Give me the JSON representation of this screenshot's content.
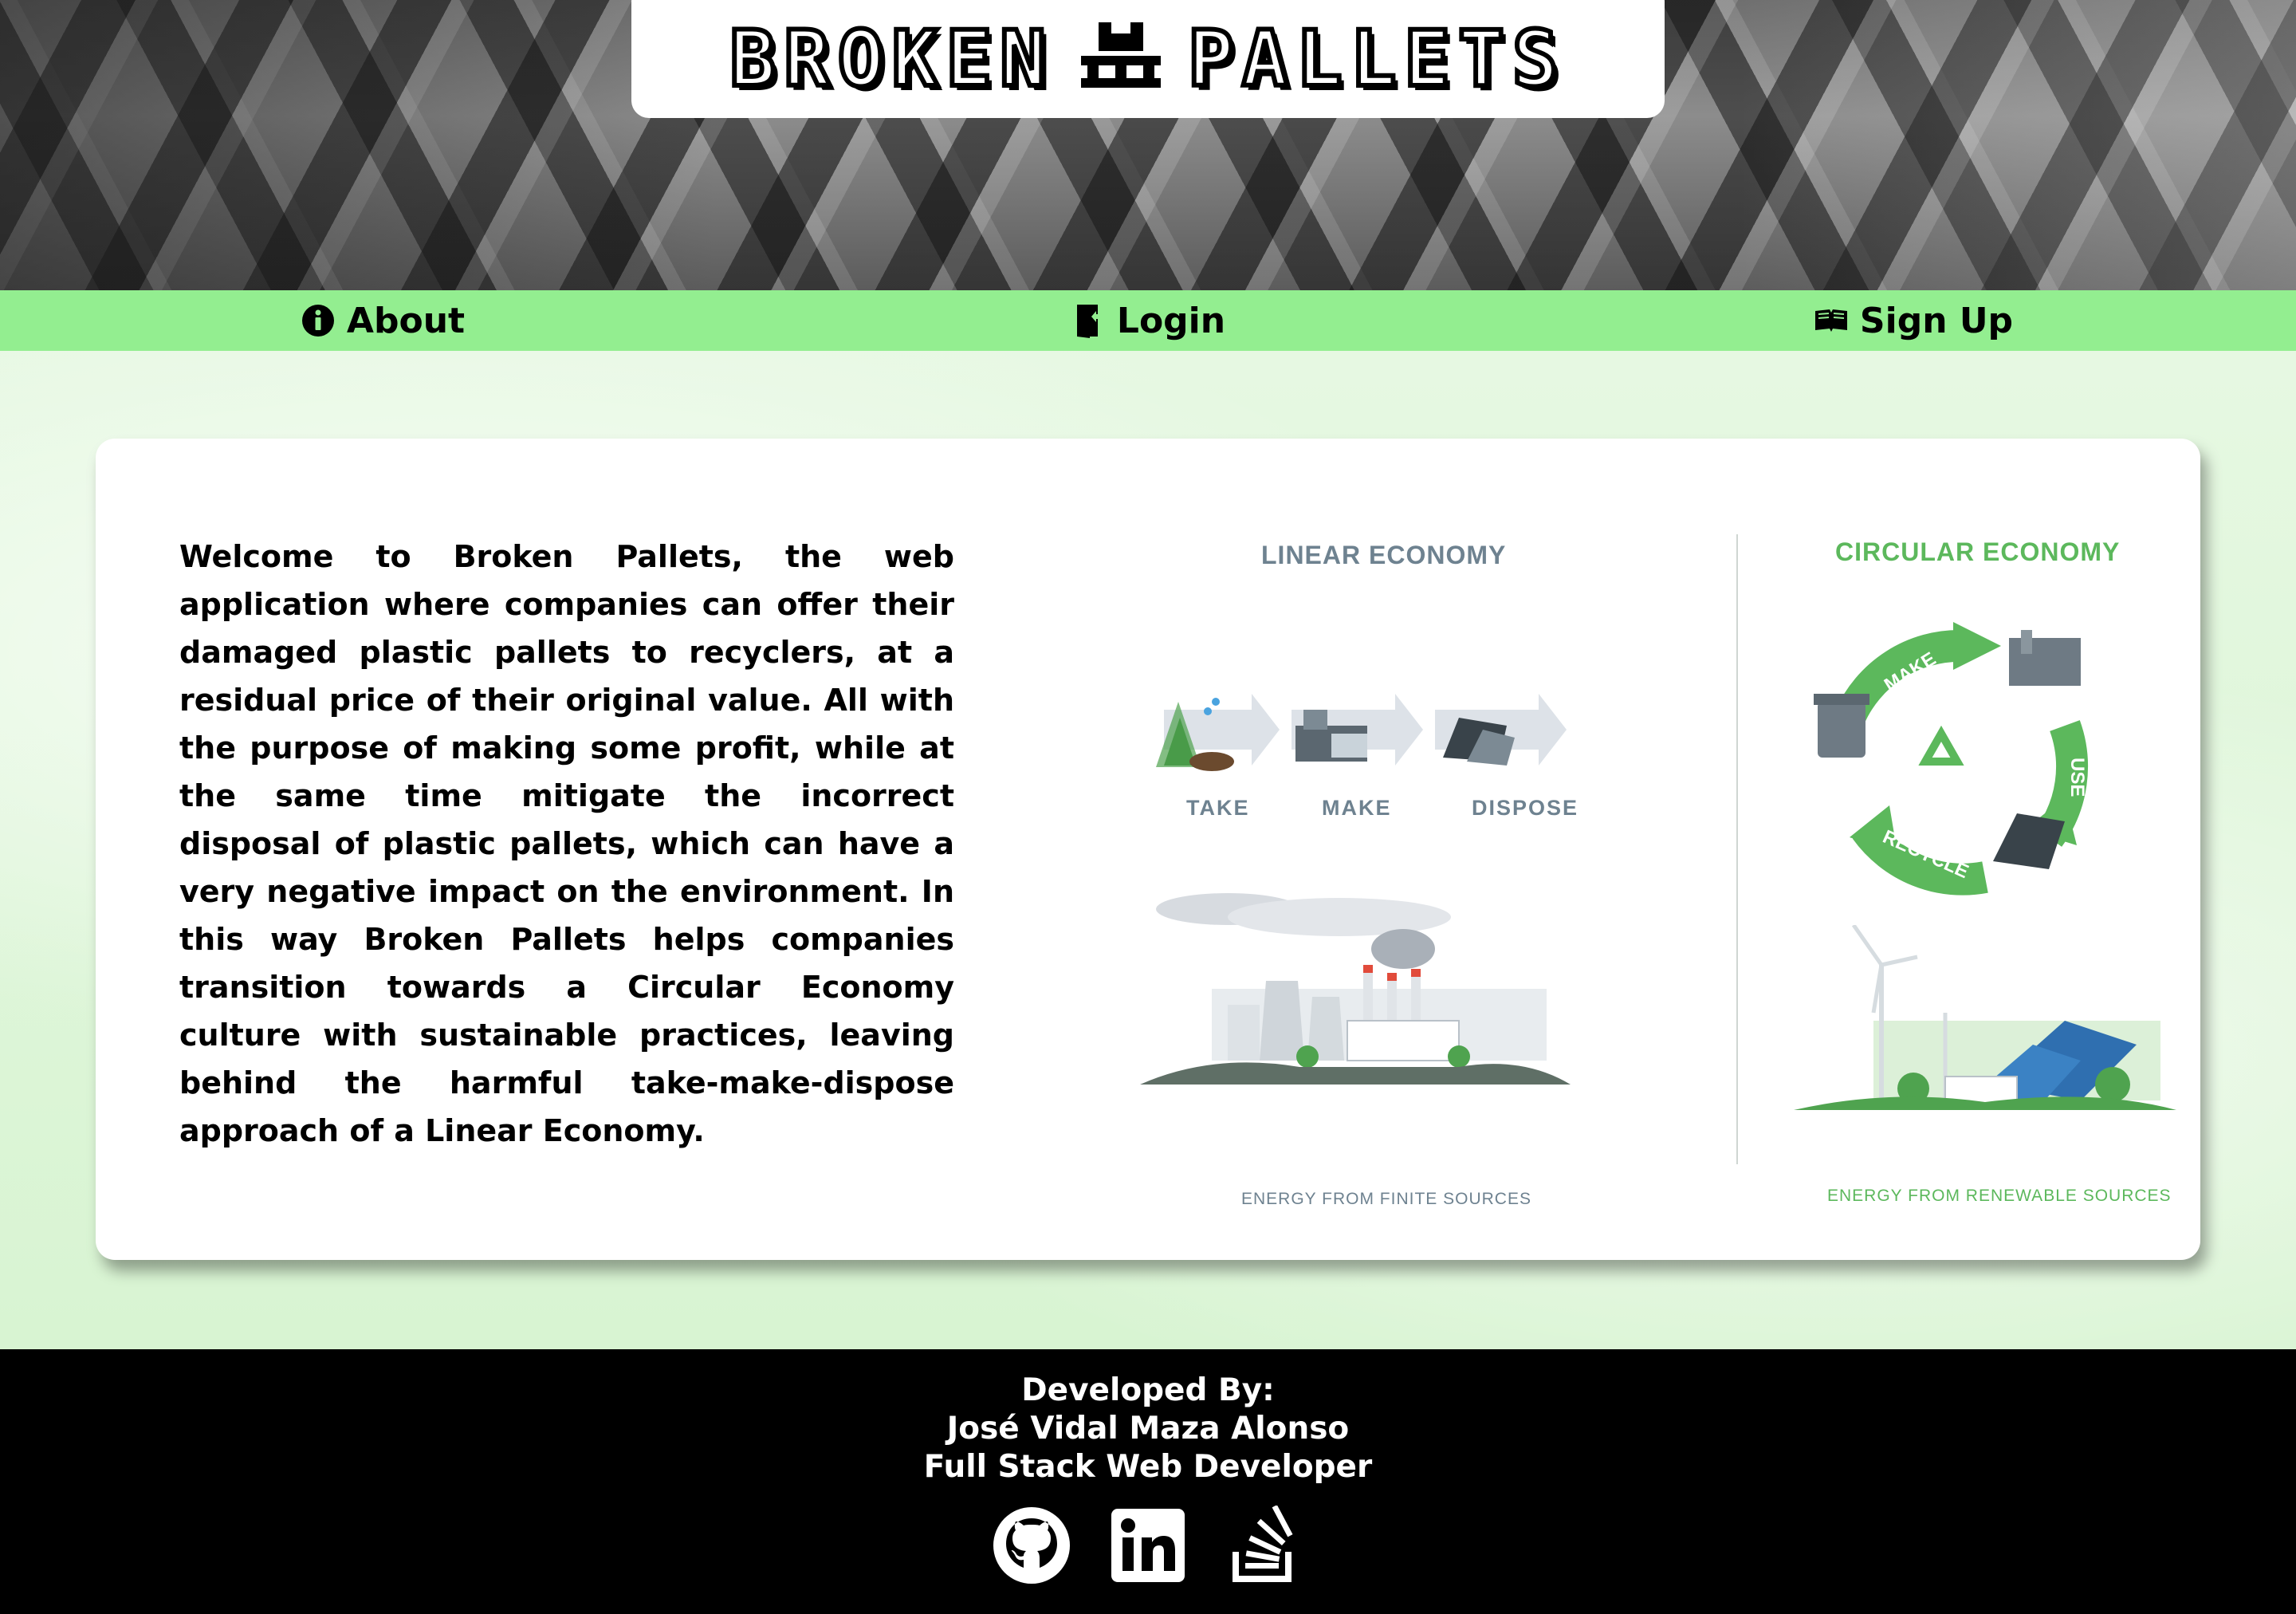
{
  "header": {
    "logo_left": "BROKEN",
    "logo_right": "PALLETS",
    "logo_icon": "pallet-icon"
  },
  "nav": {
    "items": [
      {
        "label": "About",
        "icon": "info-icon"
      },
      {
        "label": "Login",
        "icon": "login-door-icon"
      },
      {
        "label": "Sign Up",
        "icon": "open-book-icon"
      }
    ]
  },
  "main": {
    "welcome_text": "Welcome to Broken Pallets, the web application where companies can offer their damaged plastic pallets to recyclers, at a residual price of their original value. All with the purpose of making some profit, while at the same time mitigate the incorrect disposal of plastic pallets, which can have a very negative impact on the environment. In this way Broken Pallets helps companies transition towards a Circular Economy culture with sustainable practices, leaving behind the harmful take-make-dispose approach of a Linear Economy."
  },
  "infographic": {
    "linear_title": "LINEAR ECONOMY",
    "circular_title": "CIRCULAR ECONOMY",
    "steps": [
      "TAKE",
      "MAKE",
      "DISPOSE"
    ],
    "cycle": [
      "MAKE",
      "USE",
      "RECYCLE"
    ],
    "linear_caption": "ENERGY FROM FINITE SOURCES",
    "circular_caption": "ENERGY FROM RENEWABLE SOURCES",
    "colors": {
      "linear": "#6e8290",
      "circular": "#5cb85c"
    }
  },
  "footer": {
    "line1": "Developed By:",
    "line2": "José Vidal Maza Alonso",
    "line3": "Full Stack Web Developer",
    "social": [
      "github-icon",
      "linkedin-icon",
      "stackoverflow-icon"
    ]
  }
}
